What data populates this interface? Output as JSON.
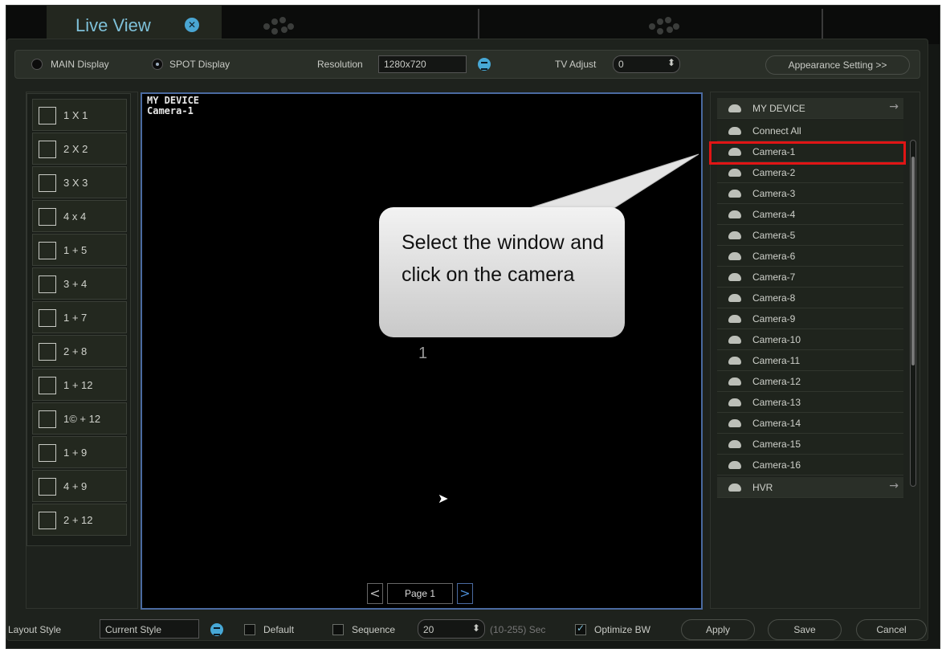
{
  "tabs": {
    "live_view": "Live View"
  },
  "options": {
    "main_display": "MAIN Display",
    "spot_display": "SPOT Display",
    "resolution_label": "Resolution",
    "resolution_value": "1280x720",
    "tv_adjust_label": "TV Adjust",
    "tv_adjust_value": "0",
    "appearance_button": "Appearance Setting >>"
  },
  "layouts": [
    "1 X 1",
    "2 X 2",
    "3 X 3",
    "4 x 4",
    "1 + 5",
    "3 + 4",
    "1 + 7",
    "2 + 8",
    "1 + 12",
    "1© + 12",
    "1 + 9",
    "4 + 9",
    "2 + 12"
  ],
  "viewport": {
    "device": "MY DEVICE",
    "camera": "Camera-1",
    "window_number": "1",
    "page_label": "Page 1"
  },
  "device_tree": {
    "my_device": "MY DEVICE",
    "connect_all": "Connect All",
    "cameras": [
      "Camera-1",
      "Camera-2",
      "Camera-3",
      "Camera-4",
      "Camera-5",
      "Camera-6",
      "Camera-7",
      "Camera-8",
      "Camera-9",
      "Camera-10",
      "Camera-11",
      "Camera-12",
      "Camera-13",
      "Camera-14",
      "Camera-15",
      "Camera-16"
    ],
    "hvr": "HVR"
  },
  "callout": {
    "text": "Select the window and click on the camera"
  },
  "bottom": {
    "layout_style_label": "Layout Style",
    "layout_style_value": "Current Style",
    "default_label": "Default",
    "sequence_label": "Sequence",
    "sequence_value": "20",
    "sequence_range": "(10-255) Sec",
    "optimize_label": "Optimize BW",
    "apply": "Apply",
    "save": "Save",
    "cancel": "Cancel"
  },
  "colors": {
    "accent": "#47a8d6",
    "highlight": "#e01515"
  }
}
